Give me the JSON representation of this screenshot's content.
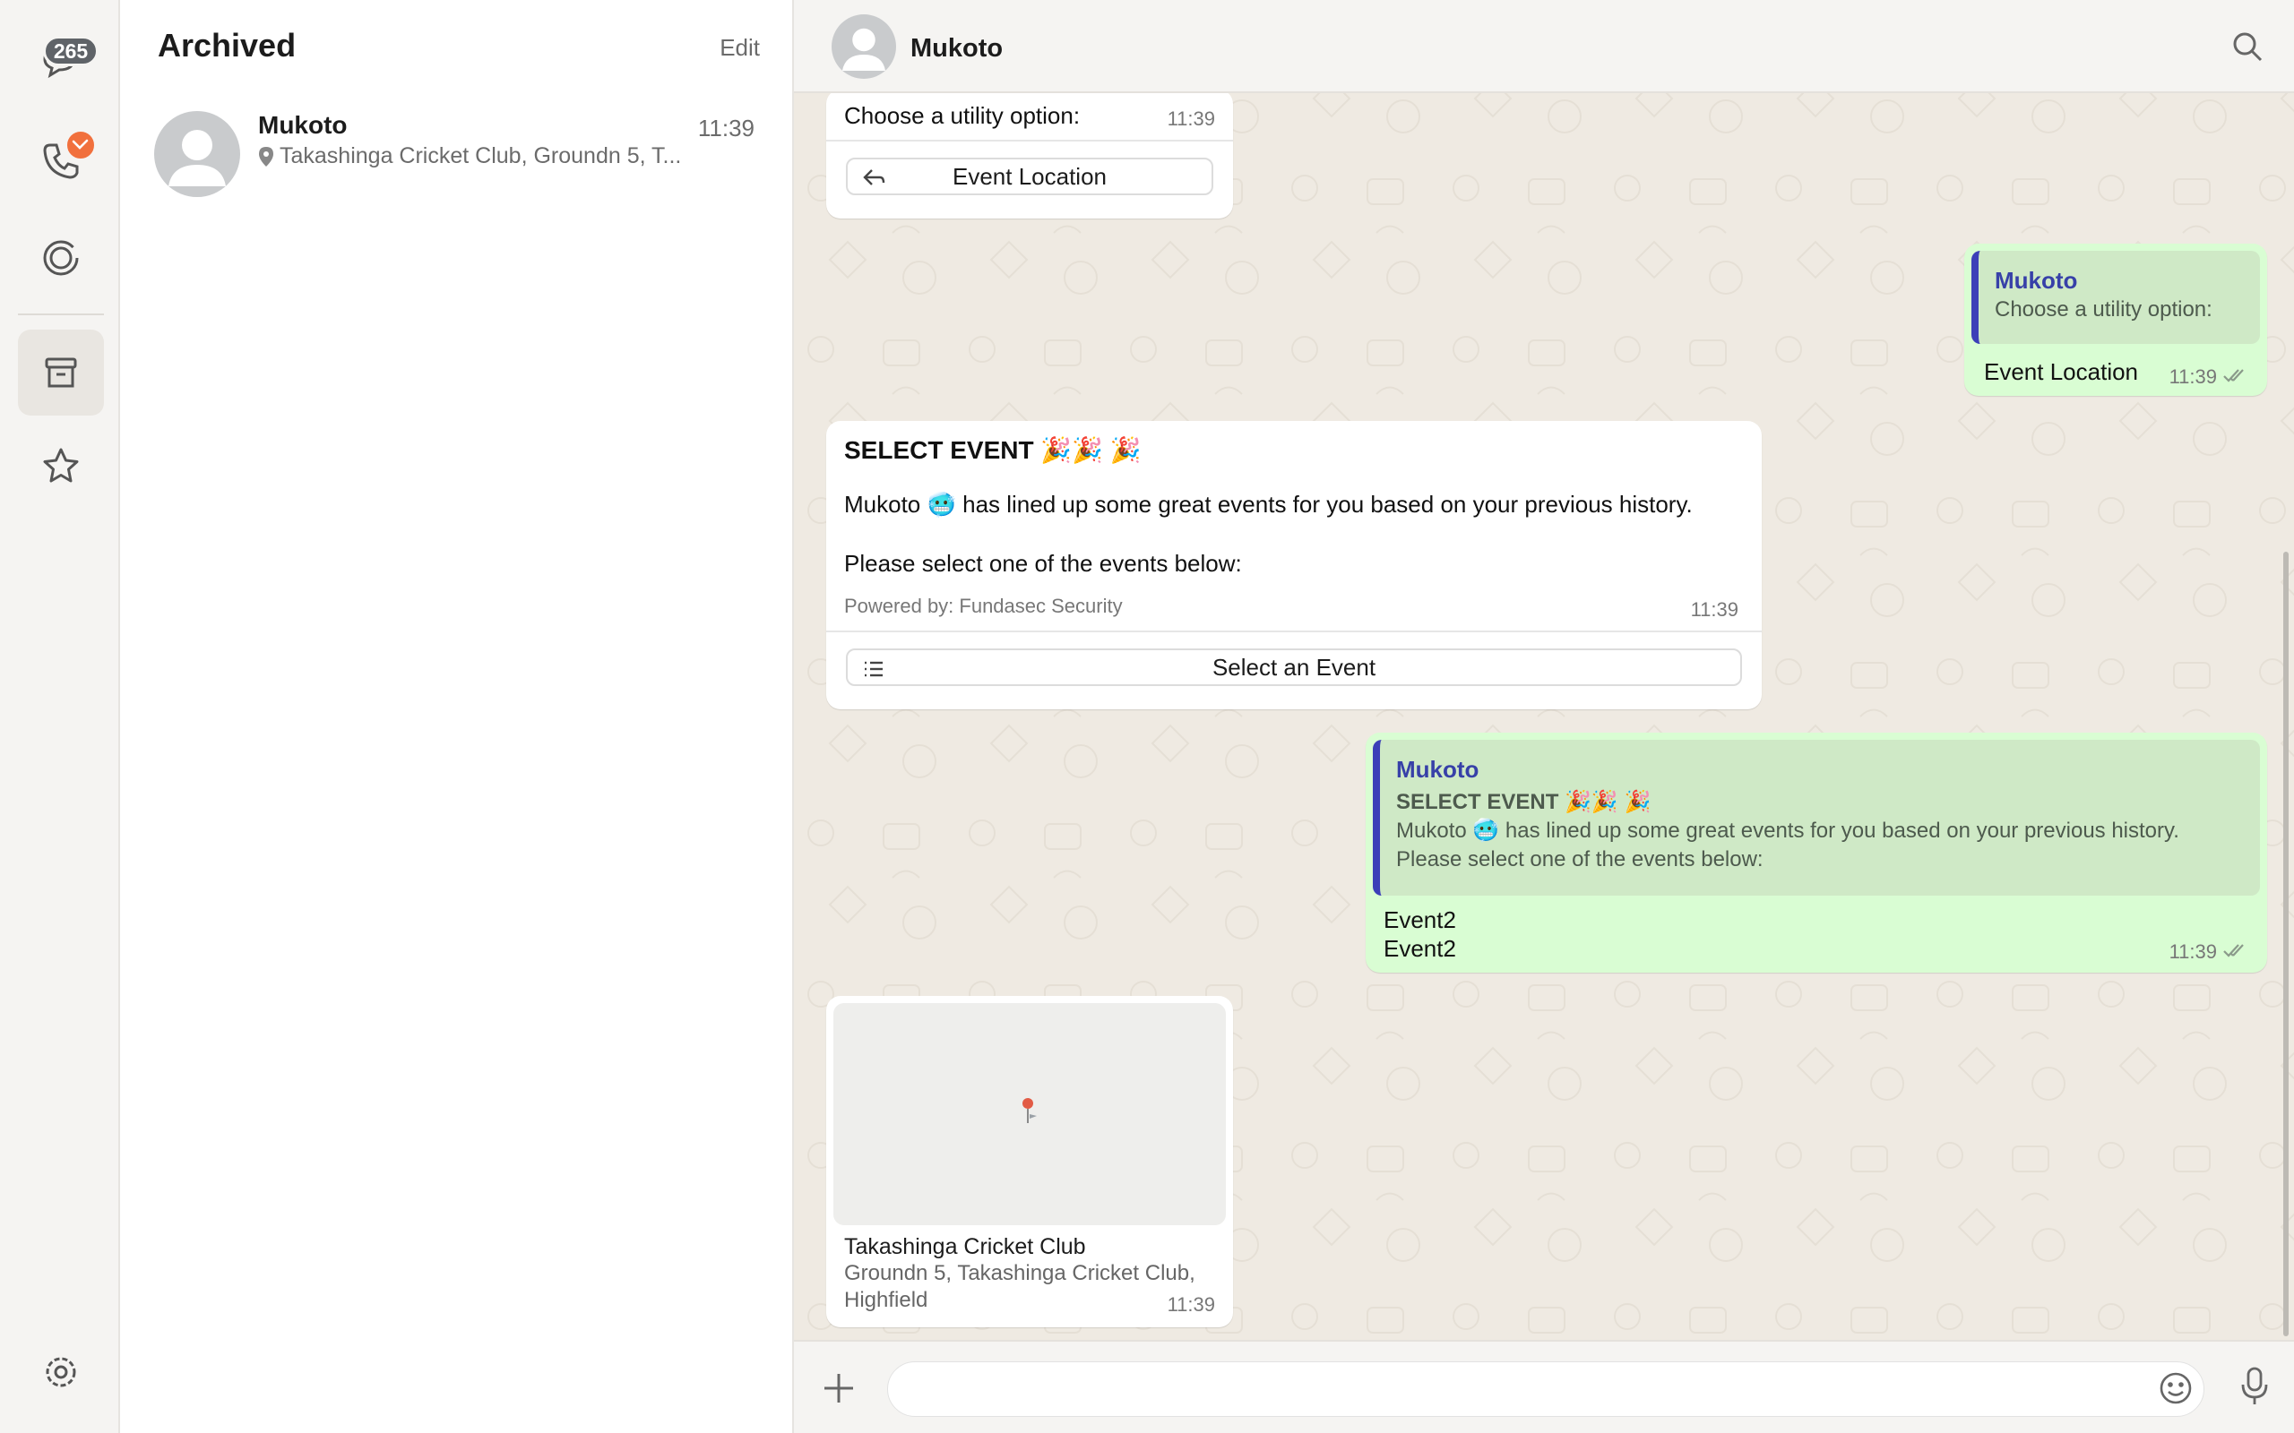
{
  "rail": {
    "chats_badge": "265",
    "items": [
      "chats",
      "calls",
      "updates",
      "archived",
      "starred",
      "settings"
    ]
  },
  "list": {
    "title": "Archived",
    "edit_label": "Edit",
    "chats": [
      {
        "name": "Mukoto",
        "time": "11:39",
        "preview": "Takashinga Cricket Club, Groundn 5, T..."
      }
    ]
  },
  "conversation": {
    "contact_name": "Mukoto",
    "msg1": {
      "text": "Choose a utility option:",
      "time": "11:39",
      "button": "Event Location"
    },
    "msg2": {
      "quote_name": "Mukoto",
      "quote_text": "Choose a utility option:",
      "text": "Event Location",
      "time": "11:39"
    },
    "msg3": {
      "title": "SELECT EVENT 🎉🎉 🎉",
      "line1_a": "Mukoto",
      "line1_emoji": "🥶",
      "line1_b": "has lined up some great events for you based on your previous history.",
      "line2": "Please select one of the events below:",
      "footer": "Powered by: Fundasec Security",
      "time": "11:39",
      "button": "Select an Event"
    },
    "msg4": {
      "quote_name": "Mukoto",
      "quote_title": "SELECT EVENT 🎉🎉 🎉",
      "quote_line1": "Mukoto 🥶 has lined up some great events for you based on your previous history.",
      "quote_line2": "Please select one of the events below:",
      "text_line1": "Event2",
      "text_line2": "Event2",
      "time": "11:39"
    },
    "msg5": {
      "place_name": "Takashinga Cricket Club",
      "address_line1": "Groundn 5, Takashinga Cricket Club,",
      "address_line2": "Highfield",
      "time": "11:39"
    }
  },
  "colors": {
    "incoming": "#ffffff",
    "outgoing": "#d9fdd3",
    "quote_bar": "#3c3fb8",
    "missed_call_badge": "#f1703d",
    "chat_bg": "#efeae2"
  }
}
